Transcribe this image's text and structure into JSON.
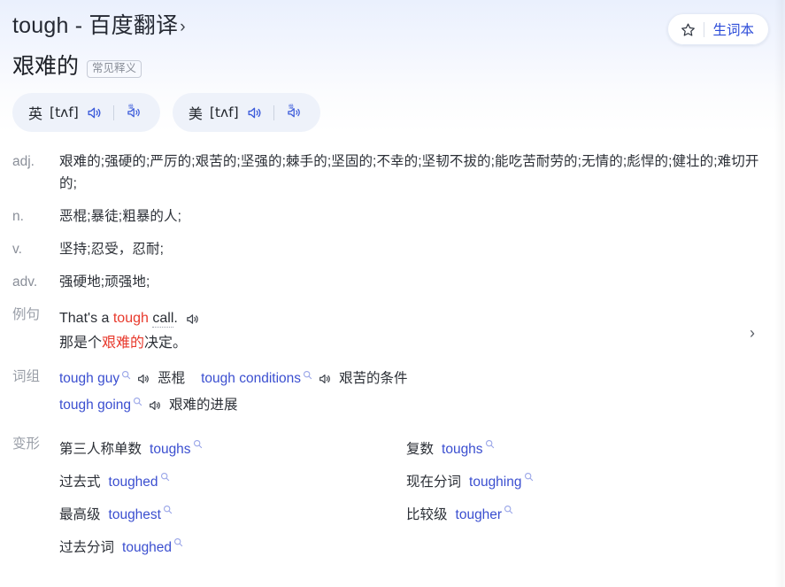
{
  "header": {
    "title_word": "tough",
    "title_sep": " - ",
    "title_source": "百度翻译",
    "title_chevron": "›",
    "vocab_button_label": "生词本",
    "star_icon": "star-outline-icon"
  },
  "meaning": {
    "text": "艰难的",
    "tag": "常见释义"
  },
  "pronunciations": [
    {
      "lang": "英",
      "ipa": "[tʌf]",
      "play_icon": "speaker-icon",
      "slow_icon": "slow-speaker-icon"
    },
    {
      "lang": "美",
      "ipa": "[tʌf]",
      "play_icon": "speaker-icon",
      "slow_icon": "slow-speaker-icon"
    }
  ],
  "definitions": [
    {
      "pos": "adj.",
      "text": "艰难的;强硬的;严厉的;艰苦的;坚强的;棘手的;坚固的;不幸的;坚韧不拔的;能吃苦耐劳的;无情的;彪悍的;健壮的;难切开的;"
    },
    {
      "pos": "n.",
      "text": "恶棍;暴徒;粗暴的人;"
    },
    {
      "pos": "v.",
      "text": "坚持;忍受，忍耐;"
    },
    {
      "pos": "adv.",
      "text": "强硬地;顽强地;"
    }
  ],
  "example": {
    "label": "例句",
    "en_before": "That's a ",
    "en_highlight": "tough",
    "en_after_space": " ",
    "en_dotted": "call",
    "en_end": ".",
    "zh_before": "那是个",
    "zh_highlight": "艰难的",
    "zh_after": "决定。",
    "audio_icon": "speaker-icon",
    "next_chevron": "›"
  },
  "phrases": {
    "label": "词组",
    "items": [
      {
        "en": "tough guy",
        "zh": "恶棍",
        "search_icon": "search-icon",
        "audio_icon": "speaker-icon"
      },
      {
        "en": "tough conditions",
        "zh": "艰苦的条件",
        "search_icon": "search-icon",
        "audio_icon": "speaker-icon"
      },
      {
        "en": "tough going",
        "zh": "艰难的进展",
        "search_icon": "search-icon",
        "audio_icon": "speaker-icon"
      }
    ]
  },
  "forms": {
    "label": "变形",
    "items": [
      {
        "key": "第三人称单数",
        "value": "toughs"
      },
      {
        "key": "复数",
        "value": "toughs"
      },
      {
        "key": "过去式",
        "value": "toughed"
      },
      {
        "key": "现在分词",
        "value": "toughing"
      },
      {
        "key": "最高级",
        "value": "toughest"
      },
      {
        "key": "比较级",
        "value": "tougher"
      },
      {
        "key": "过去分词",
        "value": "toughed"
      }
    ]
  },
  "colors": {
    "link_blue": "#3b4fd0",
    "accent_blue": "#2b4bd8",
    "highlight_red": "#e8392c",
    "label_gray": "#8a8f99",
    "text_dark": "#2b2f36",
    "pill_bg": "#eef2fa"
  }
}
